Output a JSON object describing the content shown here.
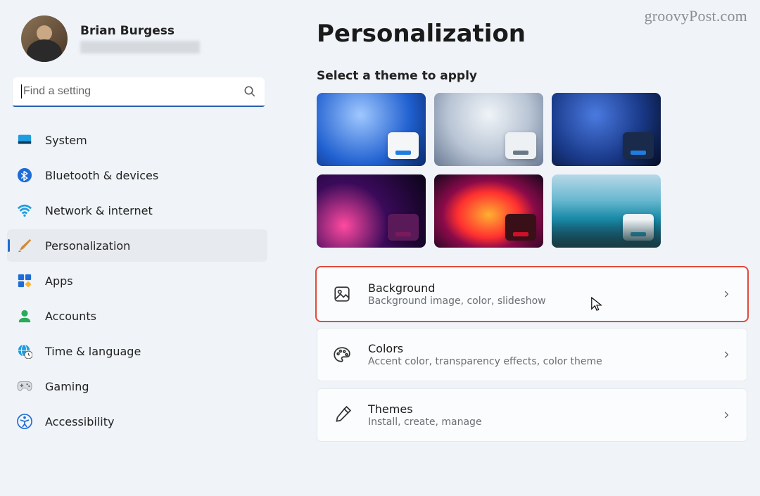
{
  "watermark": "groovyPost.com",
  "profile": {
    "name": "Brian Burgess"
  },
  "search": {
    "placeholder": "Find a setting"
  },
  "nav": [
    {
      "id": "system",
      "label": "System"
    },
    {
      "id": "bluetooth",
      "label": "Bluetooth & devices"
    },
    {
      "id": "network",
      "label": "Network & internet"
    },
    {
      "id": "personalization",
      "label": "Personalization",
      "active": true
    },
    {
      "id": "apps",
      "label": "Apps"
    },
    {
      "id": "accounts",
      "label": "Accounts"
    },
    {
      "id": "time",
      "label": "Time & language"
    },
    {
      "id": "gaming",
      "label": "Gaming"
    },
    {
      "id": "accessibility",
      "label": "Accessibility"
    }
  ],
  "page": {
    "title": "Personalization",
    "subtitle": "Select a theme to apply"
  },
  "themes": [
    {
      "id": "blue-bloom-light",
      "mini_bg": "#f4f6f8",
      "bar": "#1f7de0"
    },
    {
      "id": "grey-bloom-light",
      "mini_bg": "#eef1f4",
      "bar": "#6a7886"
    },
    {
      "id": "blue-bloom-dark",
      "mini_bg": "#1a2a4a",
      "bar": "#1f7de0"
    },
    {
      "id": "purple-glow",
      "mini_bg": "#5a1a5a",
      "bar": "#7a1a5a"
    },
    {
      "id": "abstract-red",
      "mini_bg": "#3a1018",
      "bar": "#d01028"
    },
    {
      "id": "lake-light",
      "mini_bg": "#eef3f6",
      "bar": "#2a9abf"
    }
  ],
  "options": [
    {
      "id": "background",
      "title": "Background",
      "sub": "Background image, color, slideshow",
      "highlight": true
    },
    {
      "id": "colors",
      "title": "Colors",
      "sub": "Accent color, transparency effects, color theme"
    },
    {
      "id": "themes",
      "title": "Themes",
      "sub": "Install, create, manage"
    }
  ]
}
